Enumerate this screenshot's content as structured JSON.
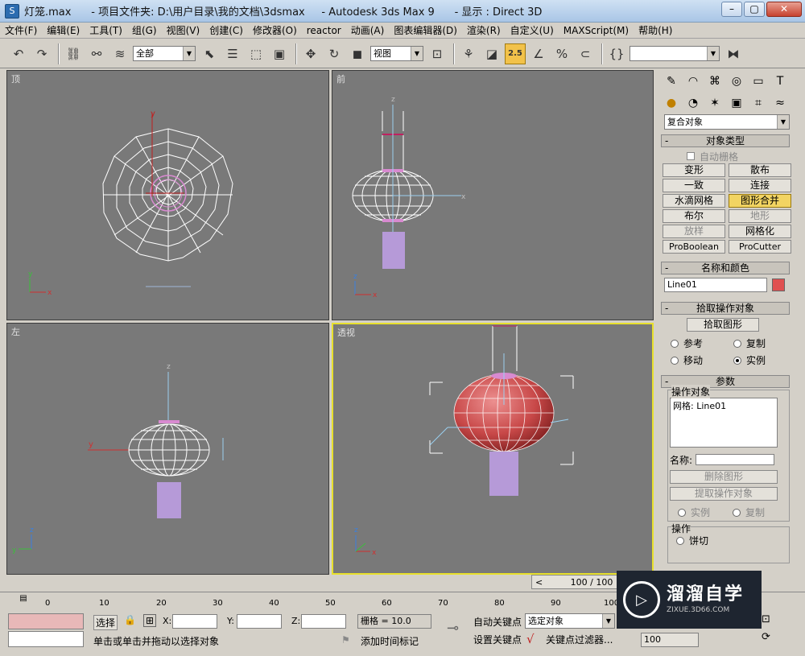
{
  "window": {
    "title": "灯笼.max      - 项目文件夹: D:\\用户目录\\我的文档\\3dsmax     - Autodesk 3ds Max 9      - 显示 : Direct 3D",
    "icon": "3ds-max-icon",
    "buttons": [
      "minimize",
      "maximize",
      "close"
    ]
  },
  "menu": [
    "文件(F)",
    "编辑(E)",
    "工具(T)",
    "组(G)",
    "视图(V)",
    "创建(C)",
    "修改器(O)",
    "reactor",
    "动画(A)",
    "图表编辑器(D)",
    "渲染(R)",
    "自定义(U)",
    "MAXScript(M)",
    "帮助(H)"
  ],
  "toolbar": {
    "selection_filter": "全部",
    "coord_system": "视图",
    "snap_value": "2.5",
    "named_selection": ""
  },
  "viewports": {
    "top": "顶",
    "front": "前",
    "left": "左",
    "perspective": "透视"
  },
  "axes": {
    "x": "x",
    "y": "y",
    "z": "z"
  },
  "command_panel": {
    "category_dropdown": "复合对象",
    "object_type": {
      "title": "对象类型",
      "autogrid": "自动栅格",
      "buttons": [
        "变形",
        "散布",
        "一致",
        "连接",
        "水滴网格",
        "图形合并",
        "布尔",
        "地形",
        "放样",
        "网格化",
        "ProBoolean",
        "ProCutter"
      ]
    },
    "name_color": {
      "title": "名称和颜色",
      "name": "Line01",
      "color": "#e05050"
    },
    "pick_operand": {
      "title": "拾取操作对象",
      "button": "拾取图形",
      "options": [
        "参考",
        "复制",
        "移动",
        "实例"
      ]
    },
    "parameters": {
      "title": "参数",
      "operands_label": "操作对象",
      "operands_list": [
        "网格: Line01"
      ],
      "name_label": "名称:",
      "delete_shape": "删除图形",
      "extract_operand": "提取操作对象",
      "instance": "实例",
      "copy": "复制",
      "operations_label": "操作",
      "cookie_cutter": "饼切"
    }
  },
  "timeline": {
    "frame": "100 / 100",
    "ticks": [
      "0",
      "10",
      "20",
      "30",
      "40",
      "50",
      "60",
      "70",
      "80",
      "90",
      "100"
    ]
  },
  "status": {
    "selection_lock": "选择",
    "x_label": "X:",
    "y_label": "Y:",
    "z_label": "Z:",
    "grid": "栅格 = 10.0",
    "auto_key": "自动关键点",
    "set_key": "设置关键点",
    "selected_object": "选定对象",
    "key_filters": "关键点过滤器...",
    "prompt": "单击或单击并拖动以选择对象",
    "add_time_tag": "添加时间标记",
    "time_value": "100"
  },
  "watermark": {
    "title": "溜溜自学",
    "url": "ZIXUE.3D66.COM"
  }
}
